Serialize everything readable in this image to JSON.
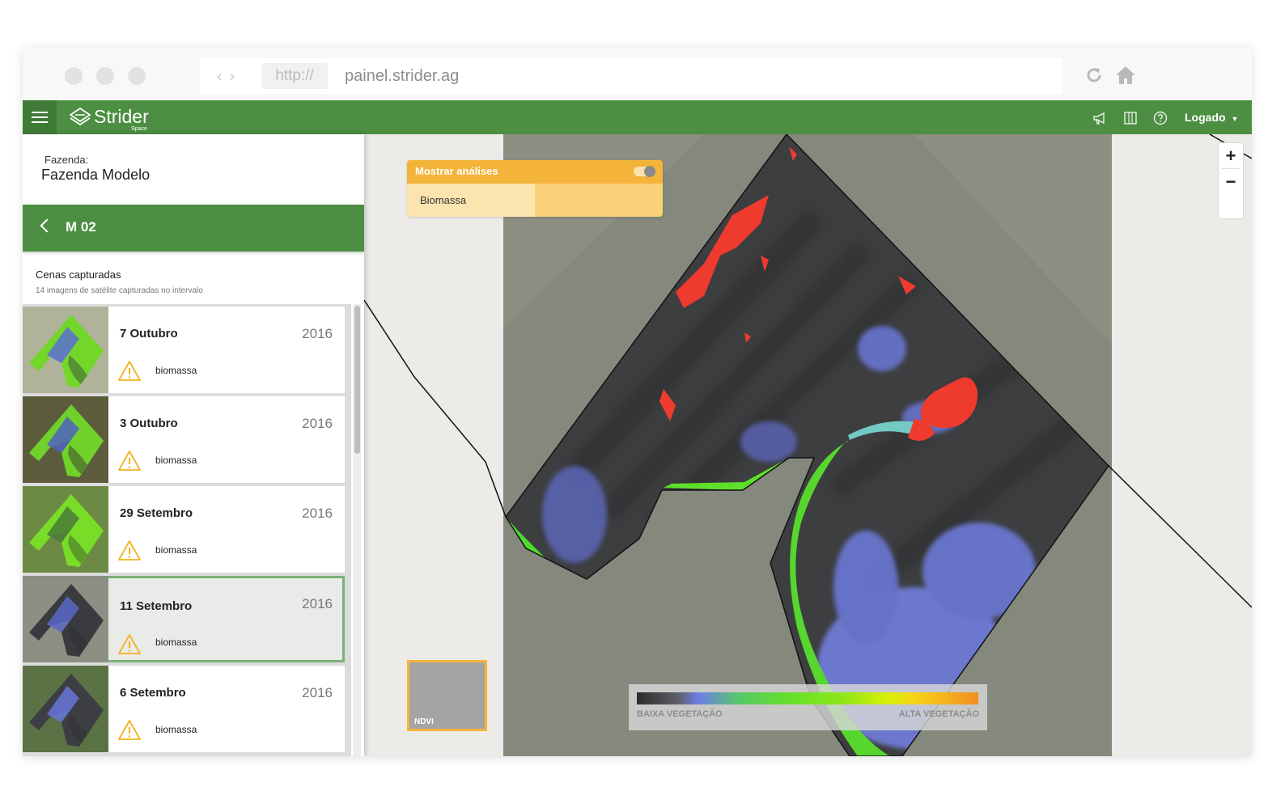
{
  "browser": {
    "url_protocol": "http://",
    "url": "painel.strider.ag"
  },
  "header": {
    "logo_text": "Strider",
    "logo_subtext": "Space",
    "user_label": "Logado",
    "user_caret": "▼"
  },
  "sidebar": {
    "farm_label": "Fazenda:",
    "farm_name": "Fazenda Modelo",
    "field_name": "M 02",
    "scenes_title": "Cenas capturadas",
    "scenes_subtitle": "14 imagens de satélite capturadas no intervalo",
    "scenes": [
      {
        "date": "7 Outubro",
        "year": "2016",
        "tag": "biomassa",
        "selected": false
      },
      {
        "date": "3 Outubro",
        "year": "2016",
        "tag": "biomassa",
        "selected": false
      },
      {
        "date": "29 Setembro",
        "year": "2016",
        "tag": "biomassa",
        "selected": false
      },
      {
        "date": "11 Setembro",
        "year": "2016",
        "tag": "biomassa",
        "selected": true
      },
      {
        "date": "6 Setembro",
        "year": "2016",
        "tag": "biomassa",
        "selected": false
      }
    ]
  },
  "map": {
    "analysis_title": "Mostrar análises",
    "analysis_toggle_on": true,
    "analysis_item": "Biomassa",
    "zoom_in": "+",
    "zoom_out": "−",
    "layer_label": "NDVI",
    "legend_low": "BAIXA VEGETAÇÃO",
    "legend_high": "ALTA VEGETAÇÃO"
  },
  "colors": {
    "brand_green": "#4c8e42",
    "accent_orange": "#f4b43a",
    "selected_border": "#7ab178"
  }
}
